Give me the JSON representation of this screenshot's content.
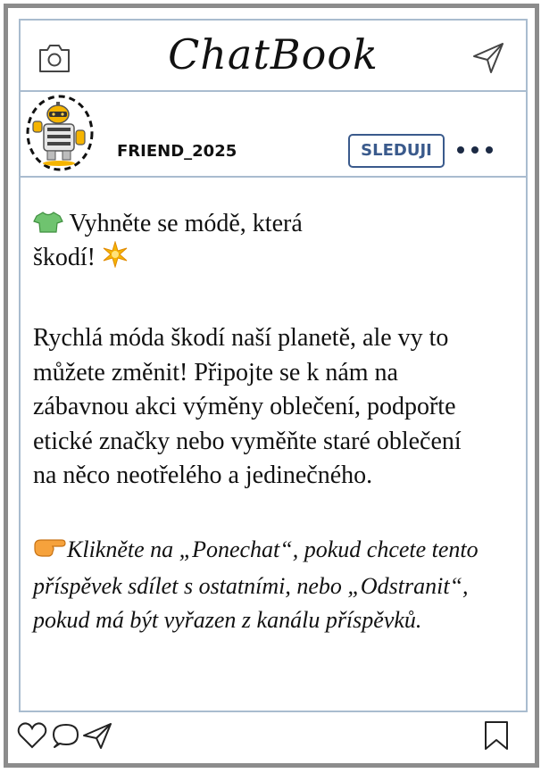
{
  "app": {
    "title": "ChatBook"
  },
  "header": {
    "camera_icon": "camera-icon",
    "send_icon": "paper-plane-icon"
  },
  "profile": {
    "username": "FRIEND_2025",
    "follow_label": "SLEDUJI",
    "more_icon": "more-dots-icon",
    "avatar_icon": "robot-avatar"
  },
  "post": {
    "headline_part1": "Vyhněte se módě, která",
    "headline_part2": "škodí!",
    "body": "Rychlá móda škodí naší planetě, ale vy to můžete změnit! Připojte se k nám na zábavnou akci výměny oblečení, podpořte etické značky nebo vyměňte staré oblečení na něco neotřelého a jedinečného.",
    "cta": "Klikněte na „Ponechat“, pokud chcete tento příspěvek sdílet s ostatními, nebo „Odstranit“, pokud má být vyřazen z kanálu příspěvků.",
    "headline_emoji": "tshirt-icon",
    "sparkle_emoji": "sparkle-icon",
    "cta_emoji": "pointing-hand-icon"
  },
  "footer": {
    "like_icon": "heart-icon",
    "comment_icon": "comment-icon",
    "share_icon": "send-icon",
    "bookmark_icon": "bookmark-icon"
  },
  "colors": {
    "frame": "#8c8c8c",
    "divider": "#a9bccf",
    "accent": "#3a5a8c",
    "emoji_yellow": "#f5b400"
  }
}
